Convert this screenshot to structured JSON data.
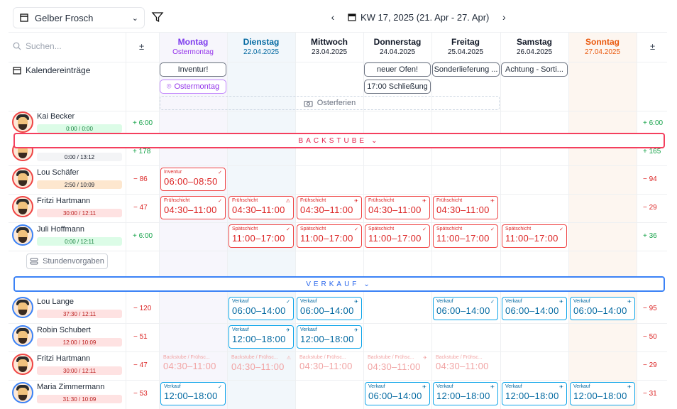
{
  "toolbar": {
    "store": "Gelber Frosch",
    "week_label": "KW 17, 2025 (21. Apr - 27. Apr)"
  },
  "header": {
    "search_placeholder": "Suchen...",
    "plusminus": "±"
  },
  "days": [
    {
      "name": "Montag",
      "date": "Ostermontag",
      "name_color": "#7c3aed",
      "date_color": "#9333ea"
    },
    {
      "name": "Dienstag",
      "date": "22.04.2025",
      "name_color": "#0369a1",
      "date_color": "#0369a1"
    },
    {
      "name": "Mittwoch",
      "date": "23.04.2025",
      "name_color": "#111827",
      "date_color": "#111827"
    },
    {
      "name": "Donnerstag",
      "date": "24.04.2025",
      "name_color": "#111827",
      "date_color": "#111827"
    },
    {
      "name": "Freitag",
      "date": "25.04.2025",
      "name_color": "#111827",
      "date_color": "#111827"
    },
    {
      "name": "Samstag",
      "date": "26.04.2025",
      "name_color": "#111827",
      "date_color": "#111827"
    },
    {
      "name": "Sonntag",
      "date": "27.04.2025",
      "name_color": "#ea580c",
      "date_color": "#ea580c"
    }
  ],
  "calendar": {
    "label": "Kalendereinträge",
    "entries": {
      "mon": "Inventur!",
      "mon_holiday": "Ostermontag",
      "thu_1": "neuer Ofen!",
      "thu_2": "17:00 Schließung",
      "fri": "Sonderlieferung ...",
      "sat": "Achtung - Sorti..."
    },
    "ferien": "Osterferien"
  },
  "groups": {
    "backstube": "BACKSTUBE",
    "verkauf": "VERKAUF"
  },
  "stunden_button": "Stundenvorgaben",
  "employees": [
    {
      "name": "Kai Becker",
      "hours": "0:00 / 0:00",
      "diff_left": "+ 6:00",
      "diff_right": "+ 6:00"
    },
    {
      "name": "",
      "hours": "0:00 / 13:12",
      "diff_left": "+ 178",
      "diff_right": "+ 165"
    },
    {
      "name": "Lou Schäfer",
      "hours": "2:50 / 10:09",
      "diff_left": "− 86",
      "diff_right": "− 94"
    },
    {
      "name": "Fritzi Hartmann",
      "hours": "30:00 / 12:11",
      "diff_left": "− 47",
      "diff_right": "− 29"
    },
    {
      "name": "Juli Hoffmann",
      "hours": "0:00 / 12:11",
      "diff_left": "+ 6:00",
      "diff_right": "+ 36"
    },
    {
      "name": "Lou Lange",
      "hours": "37:30 / 12:11",
      "diff_left": "− 120",
      "diff_right": "− 95"
    },
    {
      "name": "Robin Schubert",
      "hours": "12:00 / 10:09",
      "diff_left": "− 51",
      "diff_right": "− 50"
    },
    {
      "name": "Fritzi Hartmann",
      "hours": "30:00 / 12:11",
      "diff_left": "− 47",
      "diff_right": "− 29"
    },
    {
      "name": "Maria Zimmermann",
      "hours": "31:30 / 10:09",
      "diff_left": "− 53",
      "diff_right": "− 31"
    }
  ],
  "shifts": {
    "inventur": {
      "title": "Inventur",
      "time": "06:00–08:50"
    },
    "frueh": {
      "title": "Frühschicht",
      "time": "04:30–11:00"
    },
    "spaet": {
      "title": "Spätschicht",
      "time": "11:00–17:00"
    },
    "verkauf_morning": {
      "title": "Verkauf",
      "time": "06:00–14:00"
    },
    "verkauf_noon": {
      "title": "Verkauf",
      "time": "12:00–18:00"
    },
    "faded": {
      "title": "Backstube / Frühsc...",
      "time": "04:30–11:00"
    }
  },
  "colors": {
    "monday_bg": "#f7f6fc",
    "tuesday_bg": "#f2f7fb",
    "sunday_bg": "#fdf6f0"
  }
}
